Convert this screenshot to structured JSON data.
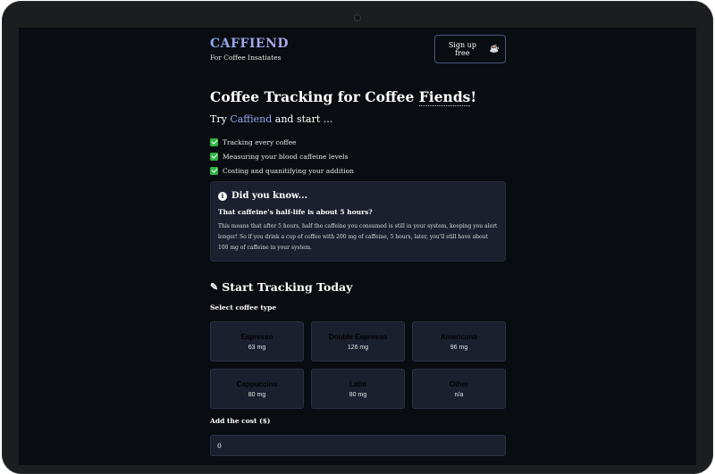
{
  "header": {
    "logo": "CAFFIEND",
    "tagline": "For Coffee Insatiates",
    "signup_label": "Sign up free",
    "signup_icon": "coffee-cup-icon"
  },
  "hero": {
    "title_prefix": "Coffee Tracking for Coffee ",
    "title_emph": "Fiends",
    "title_suffix": "!",
    "try_prefix": "Try ",
    "try_brand": "Caffiend",
    "try_suffix": " and start ..."
  },
  "features": [
    "Tracking every coffee",
    "Measuring your blood caffeine levels",
    "Costing and quanitifying your addition"
  ],
  "info": {
    "title": "Did you know...",
    "subtitle": "That caffeine's half-life is about 5 hours?",
    "body": "This means that after 5 hours, half the caffeine you consumed is still in your system, keeping you alert longer! So if you drink a cup of coffee with 200 mg of caffeine, 5 hours, later, you'll still have about 100 mg of caffeine in your system."
  },
  "tracker": {
    "title": "Start Tracking Today",
    "select_label": "Select coffee type",
    "coffees": [
      {
        "name": "Espresso",
        "mg": "63 mg"
      },
      {
        "name": "Double Espresso",
        "mg": "126 mg"
      },
      {
        "name": "Americano",
        "mg": "96 mg"
      },
      {
        "name": "Cappuccino",
        "mg": "80 mg"
      },
      {
        "name": "Latte",
        "mg": "80 mg"
      },
      {
        "name": "Other",
        "mg": "n/a"
      }
    ],
    "cost_label": "Add the cost ($)",
    "cost_value": "0"
  },
  "colors": {
    "background": "#090c10",
    "card": "#1b1f2e",
    "accent": "#8ea8f0",
    "check": "#2fb344"
  }
}
